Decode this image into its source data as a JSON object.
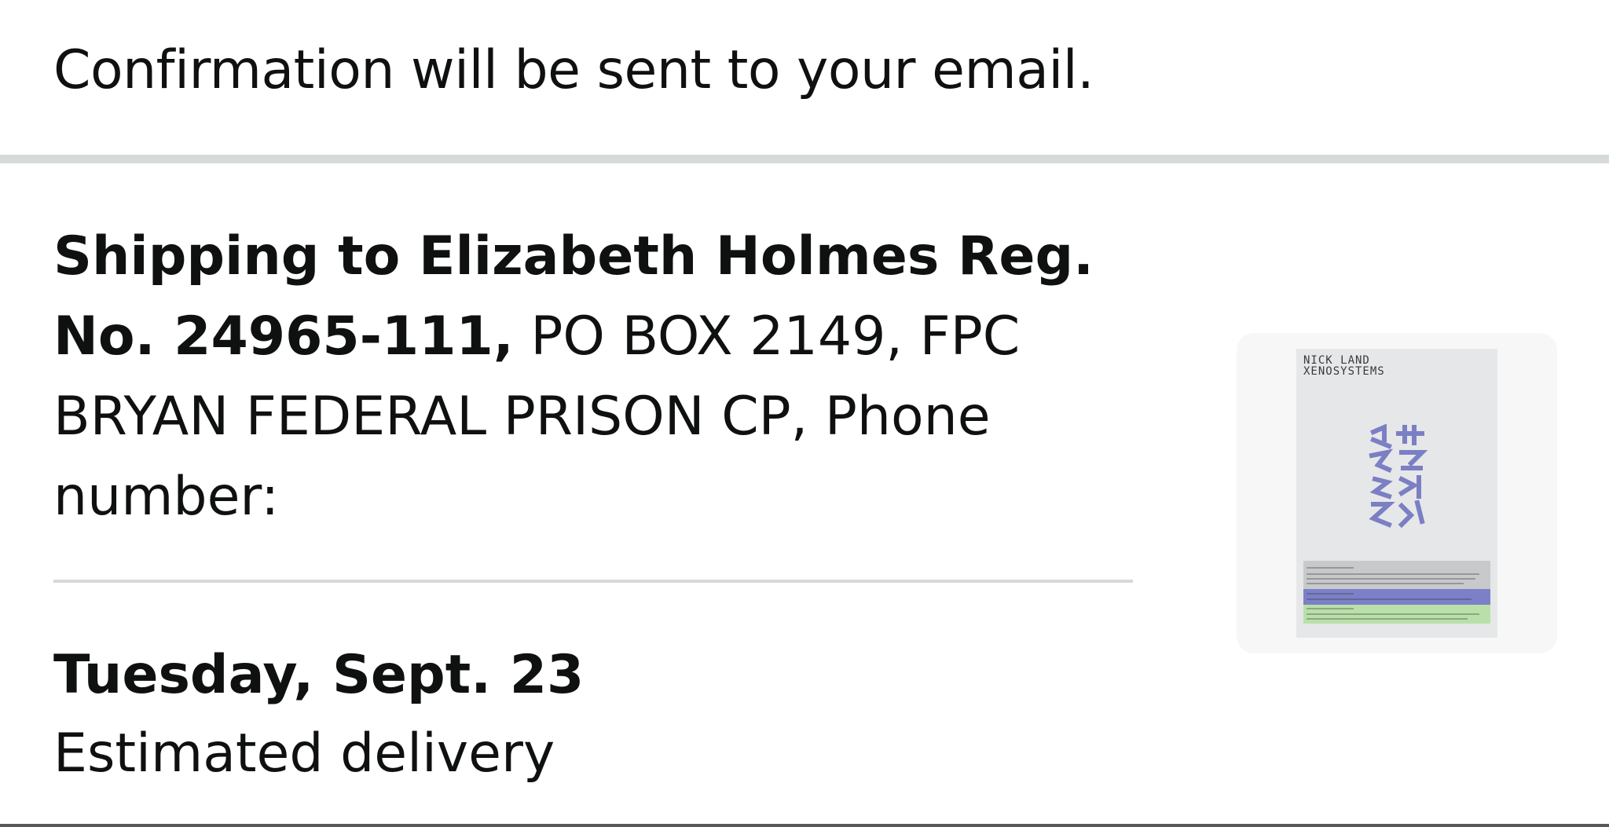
{
  "confirmation": {
    "text": "Confirmation will be sent to your email."
  },
  "shipping": {
    "bold_line1": "Shipping to Elizabeth Holmes Reg.",
    "bold_line2": "No. 24965-111,",
    "rest_line2": " PO BOX 2149, FPC",
    "line3": "BRYAN FEDERAL PRISON CP, Phone",
    "line4": "number:"
  },
  "delivery": {
    "date": "Tuesday, Sept. 23",
    "label": "Estimated delivery"
  },
  "product_image": {
    "author": "NICK LAND",
    "title": "XENOSYSTEMS",
    "colors": {
      "cover": "#e6e7e8",
      "glyphs": "#7b7fc4",
      "panel_grey": "#c8c9ca",
      "panel_blue": "#7b80c8",
      "panel_green": "#b9e0a9"
    }
  }
}
